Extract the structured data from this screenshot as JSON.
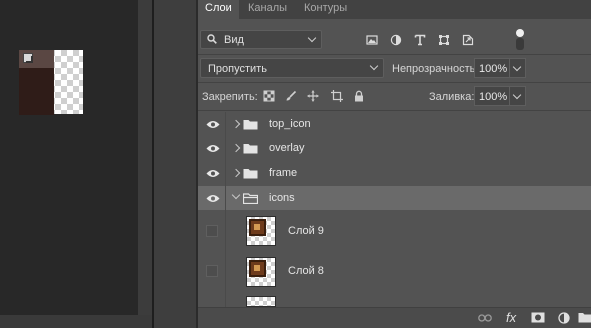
{
  "canvas": {
    "thumbnail_label": "document-canvas"
  },
  "tabs": [
    {
      "label": "Слои",
      "active": true
    },
    {
      "label": "Каналы",
      "active": false
    },
    {
      "label": "Контуры",
      "active": false
    }
  ],
  "filter": {
    "kind_value": "Вид",
    "icons": [
      "image-filter-icon",
      "adjustment-filter-icon",
      "type-filter-icon",
      "shape-filter-icon",
      "smart-object-filter-icon"
    ]
  },
  "blend": {
    "mode_value": "Пропустить",
    "opacity_label": "Непрозрачность:",
    "opacity_value": "100%"
  },
  "lock": {
    "label": "Закрепить:",
    "icons": [
      "lock-transparent-pixels-icon",
      "lock-image-pixels-icon",
      "lock-position-icon",
      "lock-artboard-icon",
      "lock-all-icon"
    ],
    "fill_label": "Заливка:",
    "fill_value": "100%"
  },
  "layers": [
    {
      "name": "top_icon",
      "type": "group",
      "visible": true,
      "expanded": false,
      "selected": false
    },
    {
      "name": "overlay",
      "type": "group",
      "visible": true,
      "expanded": false,
      "selected": false
    },
    {
      "name": "frame",
      "type": "group",
      "visible": true,
      "expanded": false,
      "selected": false
    },
    {
      "name": "icons",
      "type": "group",
      "visible": true,
      "expanded": true,
      "selected": true
    },
    {
      "name": "Слой 9",
      "type": "pixel",
      "visible": false,
      "selected": false
    },
    {
      "name": "Слой 8",
      "type": "pixel",
      "visible": false,
      "selected": false
    },
    {
      "name": "",
      "type": "pixel",
      "visible": false,
      "selected": false
    }
  ],
  "bottom_bar": {
    "icons": [
      "link-layers-icon",
      "layer-style-icon",
      "add-mask-icon",
      "adjustment-layer-icon",
      "new-group-icon"
    ],
    "fx_label": "fx"
  },
  "colors": {
    "panel_bg": "#535353",
    "selected_row_bg": "#6a6a6a",
    "tabbar_bg": "#424242"
  }
}
